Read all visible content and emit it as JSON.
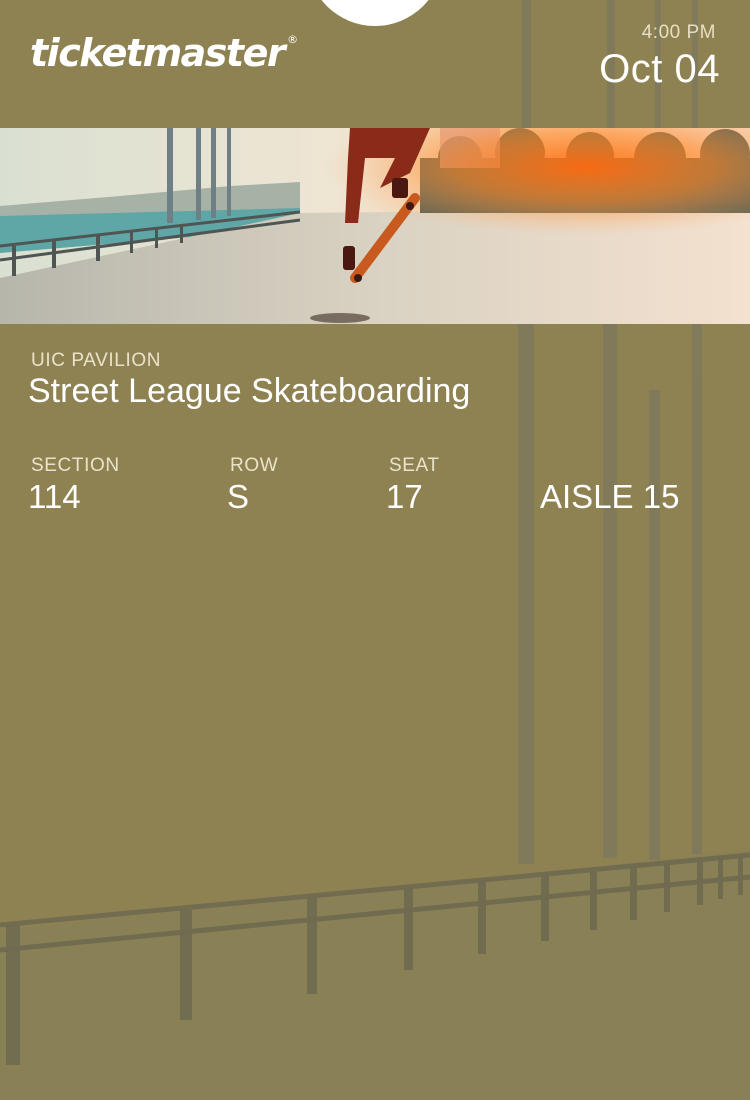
{
  "header": {
    "brand": "ticketmaster",
    "brand_mark": "®",
    "time": "4:00 PM",
    "date": "Oct 04"
  },
  "event": {
    "venue": "UIC PAVILION",
    "name": "Street League Skateboarding"
  },
  "seat_info": [
    {
      "label": "SECTION",
      "value": "114"
    },
    {
      "label": "ROW",
      "value": "S"
    },
    {
      "label": "SEAT",
      "value": "17"
    },
    {
      "label": "",
      "value": "AISLE 15"
    }
  ],
  "colors": {
    "background": "#8f8252",
    "text": "#ffffff",
    "label": "#e9e3cb"
  }
}
